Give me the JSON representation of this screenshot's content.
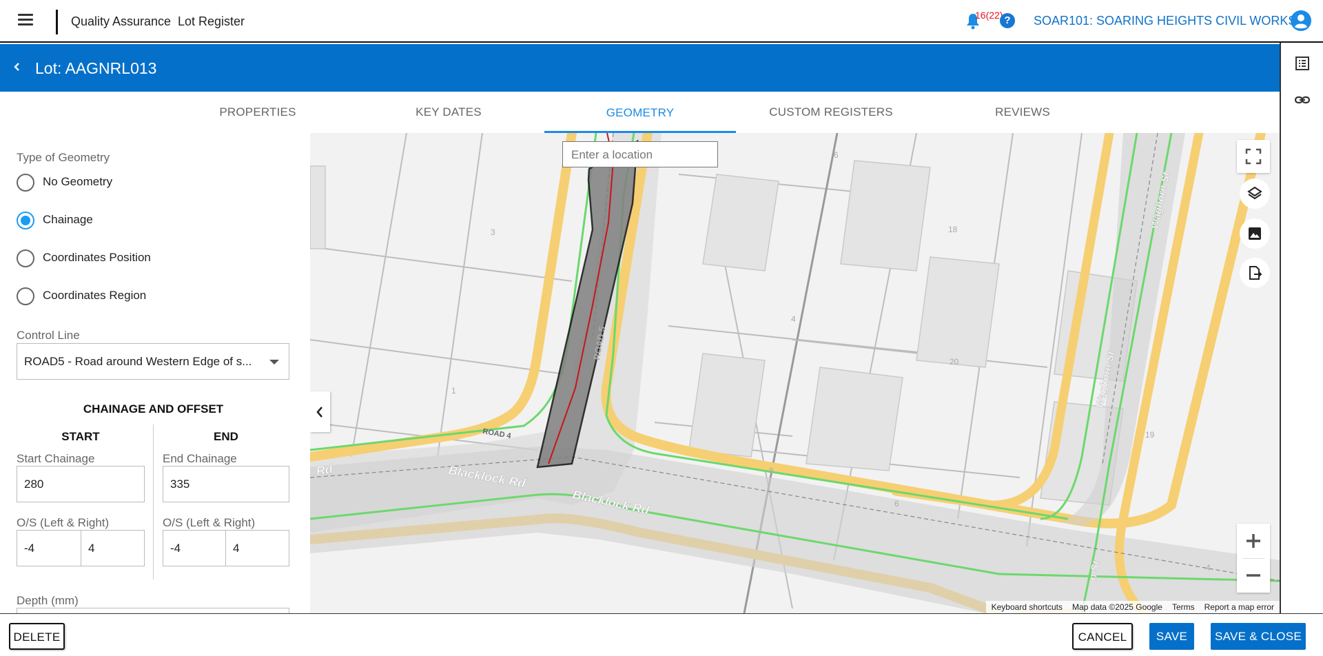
{
  "header": {
    "section": "Quality Assurance",
    "page": "Lot Register",
    "notification_count": "16(22)",
    "help_label": "?",
    "project": "SOAR101: SOARING HEIGHTS CIVIL WORKS"
  },
  "lot": {
    "title": "Lot: AAGNRL013"
  },
  "tabs": [
    {
      "label": "PROPERTIES",
      "active": false
    },
    {
      "label": "KEY DATES",
      "active": false
    },
    {
      "label": "GEOMETRY",
      "active": true
    },
    {
      "label": "CUSTOM REGISTERS",
      "active": false
    },
    {
      "label": "REVIEWS",
      "active": false
    }
  ],
  "geometry": {
    "type_label": "Type of Geometry",
    "options": [
      {
        "label": "No Geometry",
        "selected": false
      },
      {
        "label": "Chainage",
        "selected": true
      },
      {
        "label": "Coordinates Position",
        "selected": false
      },
      {
        "label": "Coordinates Region",
        "selected": false
      }
    ],
    "control_line_label": "Control Line",
    "control_line_value": "ROAD5 - Road around Western Edge of s...",
    "section_title": "CHAINAGE AND OFFSET",
    "start": {
      "title": "START",
      "chainage_label": "Start Chainage",
      "chainage": "280",
      "offset_label": "O/S (Left & Right)",
      "offset_left": "-4",
      "offset_right": "4"
    },
    "end": {
      "title": "END",
      "chainage_label": "End Chainage",
      "chainage": "335",
      "offset_label": "O/S (Left & Right)",
      "offset_left": "-4",
      "offset_right": "4"
    },
    "depth_label": "Depth (mm)"
  },
  "map": {
    "search_placeholder": "Enter a location",
    "street_labels": {
      "blacklock_1": "Blacklock Rd",
      "blacklock_2": "Blacklock Rd",
      "blacklock_rd_left": "Rd",
      "road4": "ROAD 4",
      "waghorn": "Waghorn St",
      "waghorn_top": "Waghorn St",
      "road5": "ROAD 5",
      "robertson_st": "n St"
    },
    "parcel_labels": [
      "6",
      "3",
      "18",
      "4",
      "20",
      "1",
      "19",
      "8",
      "6",
      "4"
    ],
    "attribution": {
      "shortcuts": "Keyboard shortcuts",
      "data": "Map data ©2025 Google",
      "terms": "Terms",
      "report": "Report a map error"
    },
    "colors": {
      "road_fill": "#f7d27a",
      "road_body": "#d9d9d9",
      "kerb": "#6cd86c",
      "centerline": "#c8151b",
      "lot_polygon": "#808080"
    }
  },
  "footer": {
    "delete": "DELETE",
    "cancel": "CANCEL",
    "save": "SAVE",
    "save_close": "SAVE & CLOSE"
  },
  "colors": {
    "primary": "#0570c9",
    "accent": "#1b8be6",
    "radio": "#1b9cf0",
    "notification": "#e0141e"
  }
}
